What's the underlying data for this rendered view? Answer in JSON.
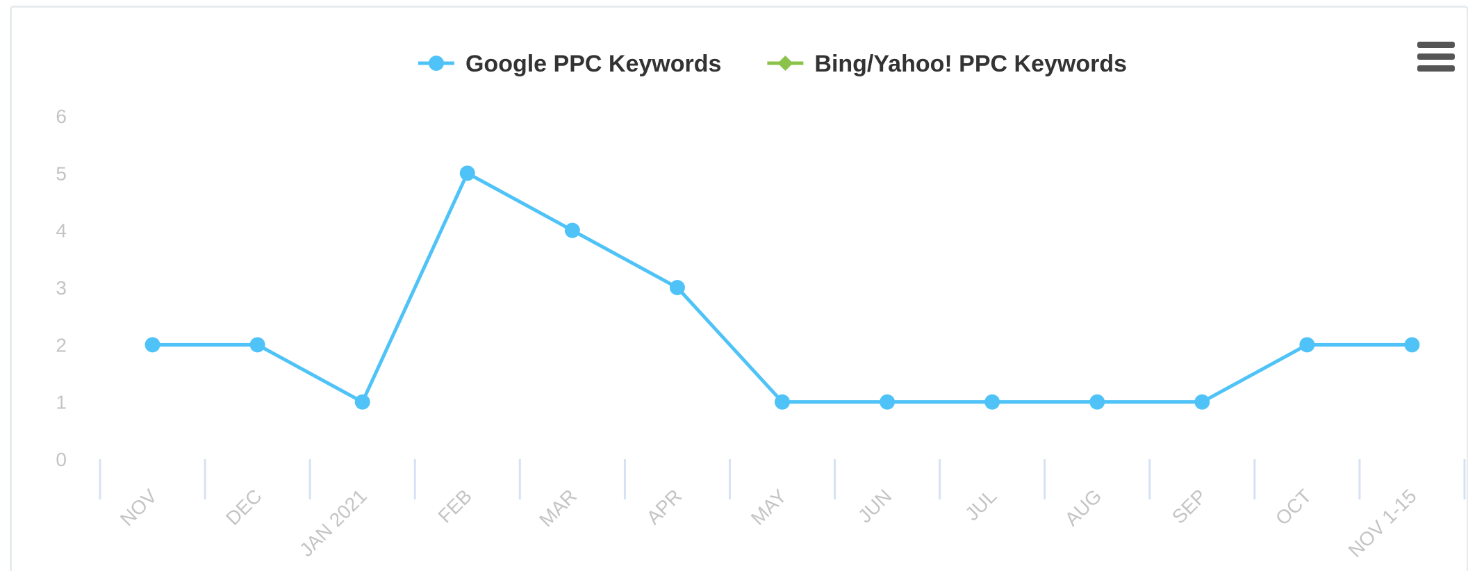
{
  "chart_data": {
    "type": "line",
    "categories": [
      "NOV",
      "DEC",
      "JAN 2021",
      "FEB",
      "MAR",
      "APR",
      "MAY",
      "JUN",
      "JUL",
      "AUG",
      "SEP",
      "OCT",
      "NOV 1-15"
    ],
    "series": [
      {
        "name": "Google PPC Keywords",
        "color": "#4fc3f7",
        "marker": "circle",
        "values": [
          2,
          2,
          1,
          5,
          4,
          3,
          1,
          1,
          1,
          1,
          1,
          2,
          2
        ]
      },
      {
        "name": "Bing/Yahoo! PPC Keywords",
        "color": "#8bc34a",
        "marker": "diamond",
        "values": []
      }
    ],
    "yticks": [
      "0",
      "1",
      "2",
      "3",
      "4",
      "5",
      "6"
    ],
    "ylim": [
      0,
      6
    ],
    "legend_position": "top-center",
    "grid": false,
    "menu_icon": "hamburger-menu-icon"
  }
}
